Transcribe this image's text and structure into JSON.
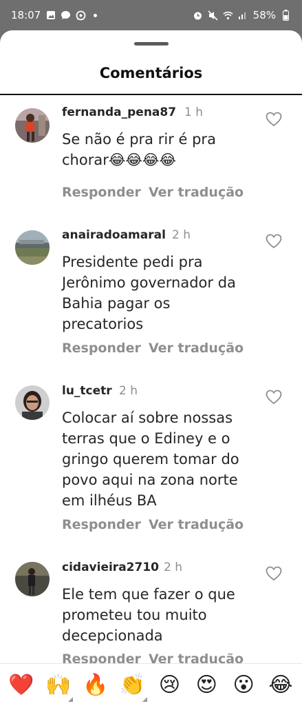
{
  "status_bar": {
    "time": "18:07",
    "battery": "58%",
    "left_icons": [
      "image-icon",
      "chat-bubble-icon",
      "whatsapp-icon",
      "dot-icon"
    ],
    "right_icons": [
      "alarm-icon",
      "mute-icon",
      "wifi-icon",
      "signal-icon"
    ]
  },
  "sheet": {
    "title": "Comentários"
  },
  "comments": [
    {
      "username": "fernanda_pena87",
      "time": "1 h",
      "text": "Se não é pra rir é pra chorar😂😂😂😂",
      "reply_label": "Responder",
      "translate_label": "Ver tradução"
    },
    {
      "username": "anairadoamaral",
      "time": "2 h",
      "text": "Presidente pedi pra Jerônimo governador da Bahia pagar os precatorios",
      "reply_label": "Responder",
      "translate_label": "Ver tradução"
    },
    {
      "username": "lu_tcetr",
      "time": "2 h",
      "text": "Colocar aí sobre nossas terras que o Ediney e o gringo querem tomar do povo aqui na zona norte em ilhéus BA",
      "reply_label": "Responder",
      "translate_label": "Ver tradução"
    },
    {
      "username": "cidavieira2710",
      "time": "2 h",
      "text": "Ele tem que fazer o que prometeu tou muito decepcionada",
      "reply_label": "Responder",
      "translate_label": "Ver tradução"
    }
  ],
  "emoji_bar": [
    "❤️",
    "🙌",
    "🔥",
    "👏",
    "😢",
    "😍",
    "😮",
    "😂"
  ],
  "colors": {
    "background_dim": "#6f6f6f",
    "text_primary": "#262626",
    "text_secondary": "#8e8e8e",
    "heart_outline": "#8e8e8e"
  }
}
